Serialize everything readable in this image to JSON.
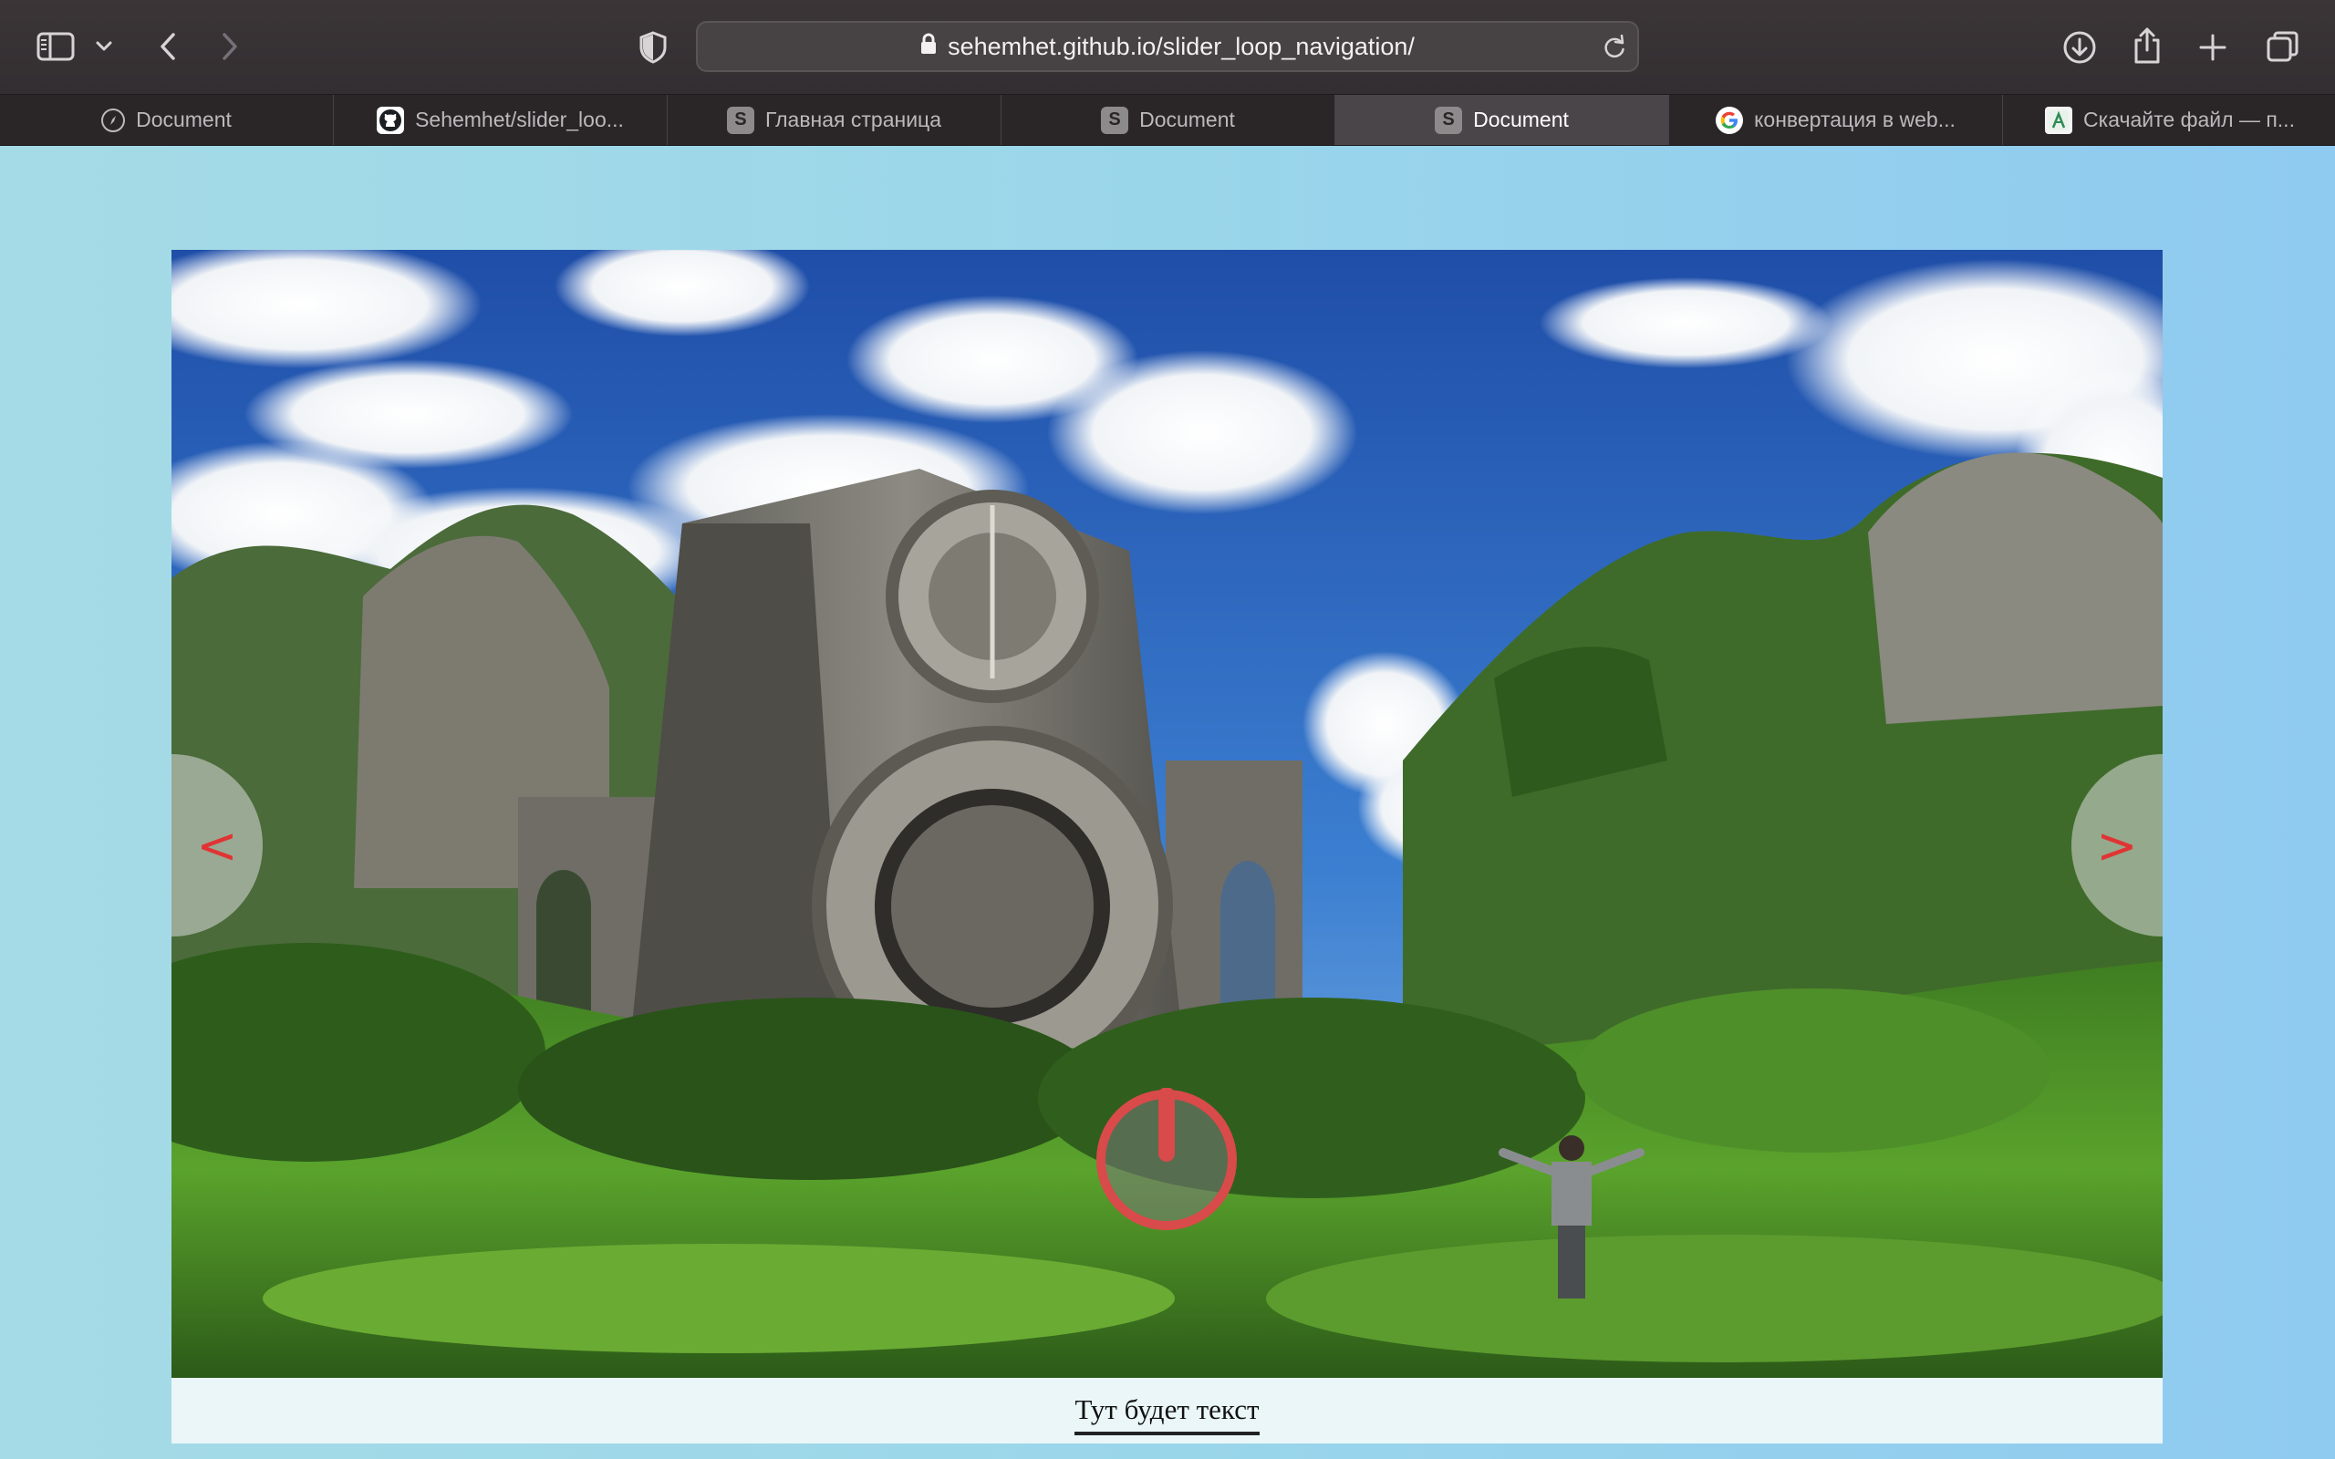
{
  "browser": {
    "url": "sehemhet.github.io/slider_loop_navigation/",
    "tabs": [
      {
        "title": "Document",
        "icon": "compass-icon",
        "active": false
      },
      {
        "title": "Sehemhet/slider_loo...",
        "icon": "github-icon",
        "active": false
      },
      {
        "title": "Главная страница",
        "icon": "s-icon",
        "active": false
      },
      {
        "title": "Document",
        "icon": "s-icon",
        "active": false
      },
      {
        "title": "Document",
        "icon": "s-icon",
        "active": true
      },
      {
        "title": "конвертация в web...",
        "icon": "google-icon",
        "active": false
      },
      {
        "title": "Скачайте файл — п...",
        "icon": "file-icon",
        "active": false
      }
    ],
    "tab_s_letter": "S",
    "tab_g_letter": "G"
  },
  "slider": {
    "prev_label": "<",
    "next_label": ">",
    "caption": "Тут будет текст",
    "accent_color": "#e03434"
  }
}
